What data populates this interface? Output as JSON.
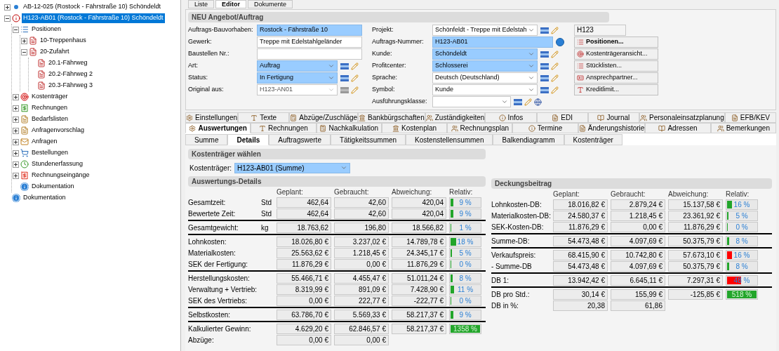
{
  "top_tabs": [
    {
      "label": "Liste",
      "selected": false
    },
    {
      "label": "Editor",
      "selected": true
    },
    {
      "label": "Dokumente",
      "selected": false
    }
  ],
  "tree": [
    {
      "label": "AB-12-025 (Rostock - Fährstraße 10) Schöndeldt",
      "kind": "project",
      "expanded": false,
      "selected": false
    },
    {
      "label": "H123-AB01 (Rostock - Fährstraße 10) Schöndeldt",
      "kind": "project-info",
      "expanded": true,
      "selected": true,
      "children": [
        {
          "label": "Positionen",
          "kind": "list",
          "expanded": true,
          "selected": false,
          "children": [
            {
              "label": "10-Treppenhaus",
              "kind": "position",
              "expanded": false,
              "selected": false
            },
            {
              "label": "20-Zufahrt",
              "kind": "position",
              "expanded": true,
              "selected": false,
              "children": [
                {
                  "label": "20.1-Fährweg",
                  "kind": "subposition",
                  "selected": false
                },
                {
                  "label": "20.2-Fährweg 2",
                  "kind": "subposition",
                  "selected": false
                },
                {
                  "label": "20.3-Fährweg 3",
                  "kind": "subposition",
                  "selected": false
                }
              ]
            }
          ]
        },
        {
          "label": "Kostenträger",
          "kind": "target",
          "expanded": false,
          "selected": false
        },
        {
          "label": "Rechnungen",
          "kind": "invoice",
          "expanded": false,
          "selected": false
        },
        {
          "label": "Bedarfslisten",
          "kind": "sheet",
          "expanded": false,
          "selected": false
        },
        {
          "label": "Anfragenvorschlag",
          "kind": "sheet",
          "expanded": false,
          "selected": false
        },
        {
          "label": "Anfragen",
          "kind": "request",
          "expanded": false,
          "selected": false
        },
        {
          "label": "Bestellungen",
          "kind": "order",
          "expanded": false,
          "selected": false
        },
        {
          "label": "Stundenerfassung",
          "kind": "time",
          "expanded": false,
          "selected": false
        },
        {
          "label": "Rechnungseingänge",
          "kind": "incoming",
          "expanded": false,
          "selected": false
        },
        {
          "label": "Dokumentation",
          "kind": "info",
          "selected": false
        }
      ]
    },
    {
      "label": "Dokumentation",
      "kind": "info",
      "selected": false
    }
  ],
  "form": {
    "title": "NEU Angebot/Auftrag",
    "left": [
      {
        "label": "Auftrags-Bauvorhaben:",
        "value": "Rostock - Fährstraße 10",
        "kind": "text",
        "highlighted": true
      },
      {
        "label": "Gewerk:",
        "value": "Treppe mit Edelstahlgeländer",
        "kind": "text",
        "highlighted": false
      },
      {
        "label": "Baustellen Nr.:",
        "kind": "text",
        "highlighted": false
      },
      {
        "label": "Art:",
        "value": "Auftrag",
        "kind": "select",
        "highlighted": true,
        "disabled": false
      },
      {
        "label": "Status:",
        "value": "In Fertigung",
        "kind": "select",
        "highlighted": true,
        "disabled": false
      },
      {
        "label": "Original aus:",
        "value": "H123-AN01",
        "kind": "select",
        "highlighted": false,
        "disabled": true
      }
    ],
    "right": [
      {
        "label": "Projekt:",
        "value": "Schönfeldt - Treppe mit Edelstah",
        "kind": "select",
        "highlighted": false,
        "disabled": false
      },
      {
        "label": "Auftrags-Nummer:",
        "value": "H123-AB01",
        "kind": "number",
        "highlighted": true
      },
      {
        "label": "Kunde:",
        "value": "Schöndeldt",
        "kind": "select",
        "highlighted": true,
        "disabled": false
      },
      {
        "label": "Profitcenter:",
        "value": "Schlosserei",
        "kind": "select",
        "highlighted": true,
        "disabled": false
      },
      {
        "label": "Sprache:",
        "value": "Deutsch (Deutschland)",
        "kind": "select",
        "highlighted": false,
        "disabled": false
      },
      {
        "label": "Symbol:",
        "value": "Kunde",
        "kind": "select",
        "highlighted": false,
        "disabled": false
      },
      {
        "label": "Ausführungsklasse:",
        "kind": "select-short",
        "highlighted": false,
        "disabled": false
      }
    ],
    "project_code": "H123",
    "buttons": [
      {
        "label": "Positionen...",
        "kind": "list",
        "default": true
      },
      {
        "label": "Kostenträgeransicht...",
        "kind": "target",
        "default": false
      },
      {
        "label": "Stücklisten...",
        "kind": "list",
        "default": false
      },
      {
        "label": "Ansprechpartner...",
        "kind": "card",
        "default": false
      },
      {
        "label": "Kreditlimit...",
        "kind": "limit",
        "default": false
      }
    ]
  },
  "tabs_row_1": [
    {
      "label": "Einstellungen",
      "selected": false
    },
    {
      "label": "Texte",
      "selected": false
    },
    {
      "label": "Abzüge/Zuschläge",
      "selected": false
    },
    {
      "label": "Bankbürgschaften",
      "selected": false
    },
    {
      "label": "Zuständigkeiten",
      "selected": false
    },
    {
      "label": "Infos",
      "selected": false
    },
    {
      "label": "EDI",
      "selected": false
    },
    {
      "label": "Journal",
      "selected": false
    },
    {
      "label": "Personaleinsatzplanung",
      "selected": false
    },
    {
      "label": "EFB/KEV",
      "selected": false
    }
  ],
  "tabs_row_2": [
    {
      "label": "Auswertungen",
      "selected": true
    },
    {
      "label": "Rechnungen",
      "selected": false
    },
    {
      "label": "Nachkalkulation",
      "selected": false
    },
    {
      "label": "Kostenplan",
      "selected": false
    },
    {
      "label": "Rechnungsplan",
      "selected": false
    },
    {
      "label": "Termine",
      "selected": false
    },
    {
      "label": "Änderungshistorie",
      "selected": false
    },
    {
      "label": "Adressen",
      "selected": false
    },
    {
      "label": "Bemerkungen",
      "selected": false
    }
  ],
  "sub_tabs": [
    {
      "label": "Summe",
      "selected": false
    },
    {
      "label": "Details",
      "selected": true
    },
    {
      "label": "Auftragswerte",
      "selected": false
    },
    {
      "label": "Tätigkeitssummen",
      "selected": false
    },
    {
      "label": "Kostenstellensummen",
      "selected": false
    },
    {
      "label": "Balkendiagramm",
      "selected": false
    },
    {
      "label": "Kostenträger",
      "selected": false
    }
  ],
  "cost_selector": {
    "title": "Kostenträger wählen",
    "label": "Kostenträger:",
    "value": "H123-AB01 (Summe)"
  },
  "details": {
    "title": "Auswertungs-Details",
    "columns": [
      "Geplant:",
      "Gebraucht:",
      "Abweichung:",
      "Relativ:"
    ],
    "groups": [
      [
        {
          "label": "Gesamtzeit:",
          "unit": "Std",
          "geplant": "462,64",
          "gebraucht": "42,60",
          "abweichung": "420,04",
          "relativ": {
            "text": "9 %",
            "level": 0.09,
            "color": "#22a52a"
          }
        },
        {
          "label": "Bewertete Zeit:",
          "unit": "Std",
          "geplant": "462,64",
          "gebraucht": "42,60",
          "abweichung": "420,04",
          "relativ": {
            "text": "9 %",
            "level": 0.09,
            "color": "#22a52a"
          }
        }
      ],
      [
        {
          "label": "Gesamtgewicht:",
          "unit": "kg",
          "geplant": "18.763,62",
          "gebraucht": "196,80",
          "abweichung": "18.566,82",
          "relativ": {
            "text": "1 %",
            "level": 0.03,
            "color": "#22a52a"
          }
        }
      ],
      [
        {
          "label": "Lohnkosten:",
          "geplant": "18.026,80 €",
          "gebraucht": "3.237,02 €",
          "abweichung": "14.789,78 €",
          "relativ": {
            "text": "18 %",
            "level": 0.18,
            "color": "#22a52a"
          }
        },
        {
          "label": "Materialkosten:",
          "geplant": "25.563,62 €",
          "gebraucht": "1.218,45 €",
          "abweichung": "24.345,17 €",
          "relativ": {
            "text": "5 %",
            "level": 0.05,
            "color": "#22a52a"
          }
        },
        {
          "label": "SEK der Fertigung:",
          "geplant": "11.876,29 €",
          "gebraucht": "0,00 €",
          "abweichung": "11.876,29 €",
          "relativ": {
            "text": "0 %",
            "level": 0.02,
            "color": "#22a52a"
          }
        }
      ],
      [
        {
          "label": "Herstellungskosten:",
          "geplant": "55.466,71 €",
          "gebraucht": "4.455,47 €",
          "abweichung": "51.011,24 €",
          "relativ": {
            "text": "8 %",
            "level": 0.08,
            "color": "#22a52a"
          }
        },
        {
          "label": "Verwaltung + Vertrieb:",
          "geplant": "8.319,99 €",
          "gebraucht": "891,09 €",
          "abweichung": "7.428,90 €",
          "relativ": {
            "text": "11 %",
            "level": 0.11,
            "color": "#22a52a"
          }
        },
        {
          "label": "SEK des Vertriebs:",
          "geplant": "0,00 €",
          "gebraucht": "222,77 €",
          "abweichung": "-222,77 €",
          "relativ": {
            "text": "0 %",
            "level": 0.02,
            "color": "#22a52a"
          }
        }
      ],
      [
        {
          "label": "Selbstkosten:",
          "geplant": "63.786,70 €",
          "gebraucht": "5.569,33 €",
          "abweichung": "58.217,37 €",
          "relativ": {
            "text": "9 %",
            "level": 0.09,
            "color": "#22a52a"
          }
        }
      ],
      [
        {
          "label": "Kalkulierter Gewinn:",
          "geplant": "4.629,20 €",
          "gebraucht": "62.846,57 €",
          "abweichung": "58.217,37 €",
          "relativ": {
            "text": "1358 %",
            "level": 1,
            "color": "#22a52a"
          }
        },
        {
          "label": "Abzüge:",
          "geplant": "0,00 €",
          "gebraucht": "0,00 €"
        }
      ]
    ]
  },
  "deckungsbeitrag": {
    "title": "Deckungsbeitrag",
    "columns": [
      "Geplant:",
      "Gebraucht:",
      "Abweichung:",
      "Relativ:"
    ],
    "groups": [
      [
        {
          "label": "Lohnkosten-DB:",
          "geplant": "18.016,82 €",
          "gebraucht": "2.879,24 €",
          "abweichung": "15.137,58 €",
          "relativ": {
            "text": "16 %",
            "level": 0.16,
            "color": "#22a52a"
          }
        },
        {
          "label": "Materialkosten-DB:",
          "geplant": "24.580,37 €",
          "gebraucht": "1.218,45 €",
          "abweichung": "23.361,92 €",
          "relativ": {
            "text": "5 %",
            "level": 0.05,
            "color": "#22a52a"
          }
        },
        {
          "label": "SEK-Kosten-DB:",
          "geplant": "11.876,29 €",
          "gebraucht": "0,00 €",
          "abweichung": "11.876,29 €",
          "relativ": {
            "text": "0 %",
            "level": 0.02,
            "color": "#22a52a"
          }
        }
      ],
      [
        {
          "label": "Summe-DB:",
          "geplant": "54.473,48 €",
          "gebraucht": "4.097,69 €",
          "abweichung": "50.375,79 €",
          "relativ": {
            "text": "8 %",
            "level": 0.08,
            "color": "#22a52a"
          }
        }
      ],
      [
        {
          "label": "Verkaufspreis:",
          "geplant": "68.415,90 €",
          "gebraucht": "10.742,80 €",
          "abweichung": "57.673,10 €",
          "relativ": {
            "text": "16 %",
            "level": 0.16,
            "color": "#ff0000"
          }
        },
        {
          "label": "- Summe-DB",
          "geplant": "54.473,48 €",
          "gebraucht": "4.097,69 €",
          "abweichung": "50.375,79 €",
          "relativ": {
            "text": "8 %",
            "level": 0.08,
            "color": "#22a52a"
          }
        }
      ],
      [
        {
          "label": "DB 1:",
          "geplant": "13.942,42 €",
          "gebraucht": "6.645,11 €",
          "abweichung": "7.297,31 €",
          "relativ": {
            "text": "48 %",
            "level": 0.48,
            "color": "#ff0000"
          }
        }
      ],
      [
        {
          "label": "DB pro Std.:",
          "geplant": "30,14 €",
          "gebraucht": "155,99 €",
          "abweichung": "-125,85 €",
          "relativ": {
            "text": "518 %",
            "level": 1,
            "color": "#22a52a"
          }
        },
        {
          "label": "DB in %:",
          "geplant": "20,38",
          "gebraucht": "61,86"
        }
      ]
    ]
  }
}
